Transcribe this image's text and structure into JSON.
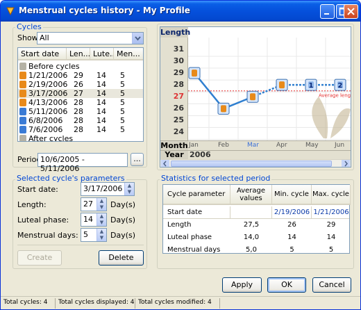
{
  "window": {
    "title": "Menstrual cycles history - My Profile"
  },
  "cycles": {
    "group_label": "Cycles",
    "show_label": "Show:",
    "show_value": "All",
    "columns": [
      "Start date",
      "Len...",
      "Lute...",
      "Men..."
    ],
    "rows": [
      {
        "date": "Before cycles",
        "len": "",
        "lut": "",
        "men": "",
        "type": "gray"
      },
      {
        "date": "1/21/2006",
        "len": "29",
        "lut": "14",
        "men": "5",
        "type": "orange"
      },
      {
        "date": "2/19/2006",
        "len": "26",
        "lut": "14",
        "men": "5",
        "type": "orange"
      },
      {
        "date": "3/17/2006",
        "len": "27",
        "lut": "14",
        "men": "5",
        "type": "orange"
      },
      {
        "date": "4/13/2006",
        "len": "28",
        "lut": "14",
        "men": "5",
        "type": "orange"
      },
      {
        "date": "5/11/2006",
        "len": "28",
        "lut": "14",
        "men": "5",
        "type": "blue"
      },
      {
        "date": "6/8/2006",
        "len": "28",
        "lut": "14",
        "men": "5",
        "type": "blue"
      },
      {
        "date": "7/6/2006",
        "len": "28",
        "lut": "14",
        "men": "5",
        "type": "blue"
      },
      {
        "date": "After cycles",
        "len": "",
        "lut": "",
        "men": "",
        "type": "gray"
      }
    ],
    "period_label": "Period:",
    "period_value": "10/6/2005 - 5/11/2006",
    "browse_label": "..."
  },
  "params": {
    "group_label": "Selected cycle's parameters",
    "start_label": "Start date:",
    "start_value": "3/17/2006",
    "length_label": "Length:",
    "length_value": "27",
    "luteal_label": "Luteal phase:",
    "luteal_value": "14",
    "menstrual_label": "Menstrual days:",
    "menstrual_value": "5",
    "unit": "Day(s)",
    "create_label": "Create",
    "delete_label": "Delete"
  },
  "chart_data": {
    "type": "line",
    "ylabel": "Length",
    "yticks": [
      "31",
      "30",
      "29",
      "28",
      "27",
      "26",
      "25",
      "24"
    ],
    "ylim": [
      23.5,
      31.7
    ],
    "xlabel": "Month",
    "months": [
      "Jan",
      "Feb",
      "Mar",
      "Apr",
      "May",
      "Jun"
    ],
    "year_label": "Year",
    "year": "2006",
    "series": [
      {
        "values": [
          29,
          26,
          27,
          28,
          28,
          28
        ],
        "icons": [
          "orange",
          "orange",
          "orange",
          "orange",
          "blue",
          "blue"
        ],
        "labels": [
          "",
          "",
          "",
          "",
          "1",
          "2"
        ]
      }
    ],
    "average": 27.5,
    "average_label": "Average length"
  },
  "stats": {
    "group_label": "Statistics for selected period",
    "headers": [
      "Cycle parameter",
      "Average values",
      "Min. cycle",
      "Max. cycle"
    ],
    "rows": [
      [
        "Start date",
        "",
        "2/19/2006",
        "1/21/2006"
      ],
      [
        "Length",
        "27,5",
        "26",
        "29"
      ],
      [
        "Luteal phase",
        "14,0",
        "14",
        "14"
      ],
      [
        "Menstrual days",
        "5,0",
        "5",
        "5"
      ]
    ]
  },
  "buttons": {
    "apply": "Apply",
    "ok": "OK",
    "cancel": "Cancel"
  },
  "status": {
    "total": "Total cycles: 4",
    "displayed": "Total cycles displayed: 4",
    "modified": "Total cycles modified: 4"
  },
  "colors": {
    "accent": "#0046d5",
    "orange": "#e88a1a",
    "blue": "#3a7bd5",
    "line": "#2f7fd0",
    "average": "#e53030"
  }
}
